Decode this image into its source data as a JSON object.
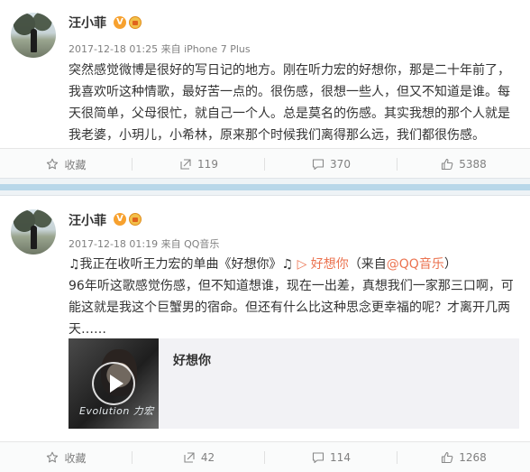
{
  "posts": [
    {
      "author": "汪小菲",
      "v_badge": "V",
      "meta": "2017-12-18 01:25 来自 iPhone 7 Plus",
      "text": "突然感觉微博是很好的写日记的地方。刚在听力宏的好想你，那是二十年前了，我喜欢听这种情歌，最好苦一点的。很伤感，很想一些人，但又不知道是谁。每天很简单，父母很忙，就自己一个人。总是莫名的伤感。其实我想的那个人就是我老婆，小玥儿，小希林，原来那个时候我们离得那么远，我们都很伤感。",
      "actions": {
        "favorite": "收藏",
        "repost": "119",
        "comment": "370",
        "like": "5388"
      }
    },
    {
      "author": "汪小菲",
      "v_badge": "V",
      "meta": "2017-12-18 01:19 来自 QQ音乐",
      "line1_prefix": "♫我正在收听王力宏的单曲《好想你》♫ ",
      "line1_link": "▷ 好想你",
      "line1_paren_open": "（来自",
      "line1_source": "@QQ音乐",
      "line1_paren_close": "）",
      "text": "96年听这歌感觉伤感，但不知道想谁，现在一出差，真想我们一家那三口啊，可能这就是我这个巨蟹男的宿命。但还有什么比这种思念更幸福的呢？才离开几两天……",
      "music_card": {
        "title": "好想你",
        "cover_text": "Evolution 力宏"
      },
      "actions": {
        "favorite": "收藏",
        "repost": "42",
        "comment": "114",
        "like": "1268"
      }
    }
  ],
  "colors": {
    "link": "#eb7350",
    "separator": "#b8d7e9",
    "vip": "#f7a12f"
  },
  "icons": [
    "star-icon",
    "repost-icon",
    "comment-icon",
    "like-icon",
    "play-icon",
    "vip-badge-icon",
    "crown-badge-icon"
  ]
}
